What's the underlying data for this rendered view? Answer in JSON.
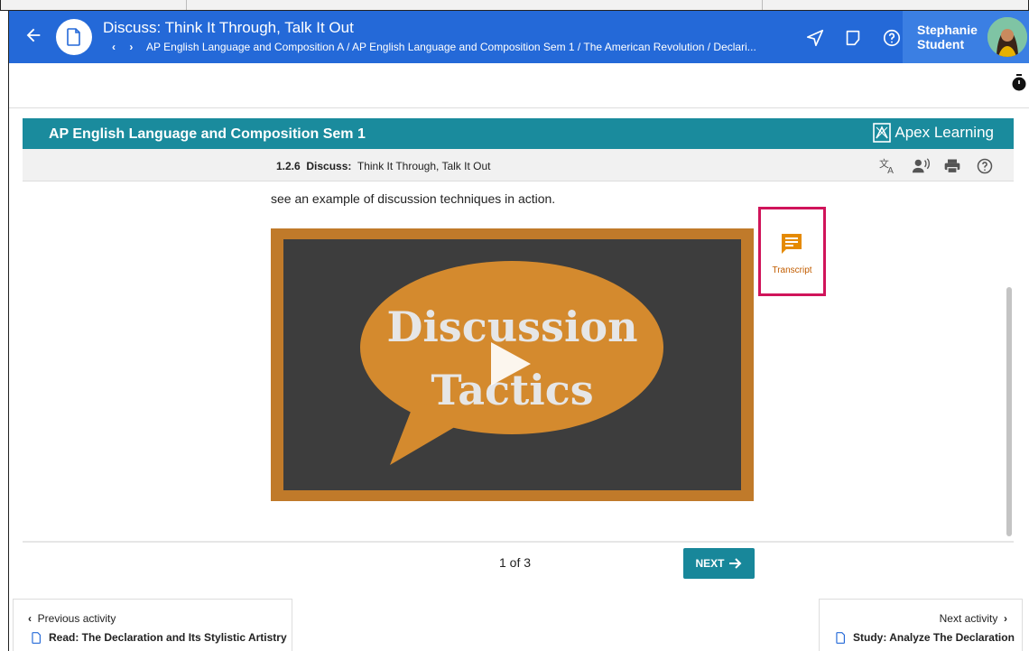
{
  "header": {
    "title": "Discuss: Think It Through, Talk It Out",
    "breadcrumb": "AP English Language and Composition A / AP English Language and Composition Sem 1 / The American Revolution / Declari...",
    "user_first": "Stephanie",
    "user_last": "Student",
    "icons": [
      "back-arrow-icon",
      "document-icon",
      "send-icon",
      "notes-icon",
      "help-icon"
    ]
  },
  "course": {
    "title": "AP English Language and Composition Sem 1",
    "brand": "Apex Learning",
    "activity_number": "1.2.6",
    "activity_type": "Discuss:",
    "activity_title": "Think It Through, Talk It Out"
  },
  "content": {
    "intro_text": "see an example of discussion techniques in action.",
    "video_line1": "Discussion",
    "video_line2": "Tactics",
    "transcript_label": "Transcript"
  },
  "pager": {
    "count": "1 of 3",
    "next_label": "NEXT"
  },
  "nav": {
    "prev_head": "Previous activity",
    "prev_link": "Read: The Declaration and Its Stylistic Artistry",
    "next_head": "Next activity",
    "next_link": "Study: Analyze The Declaration"
  },
  "colors": {
    "appbar": "#2469d8",
    "course_bar": "#1a8b9d",
    "transcript_border": "#d0145a",
    "transcript_icon": "#e58a00"
  }
}
